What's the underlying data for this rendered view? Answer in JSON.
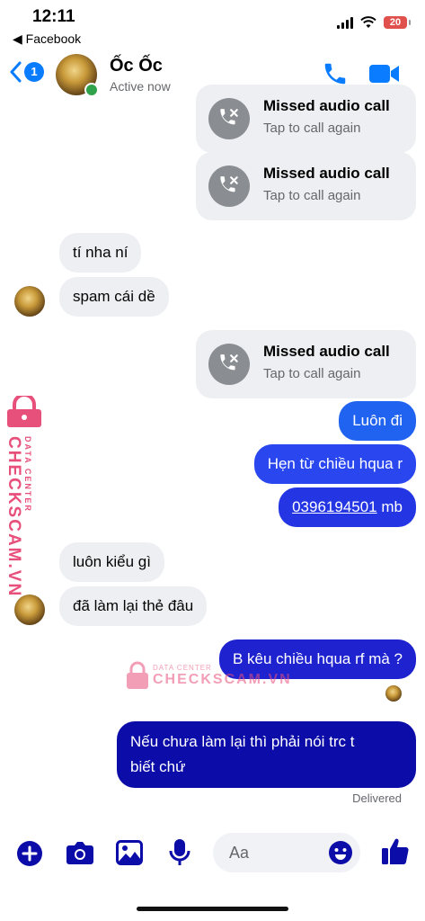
{
  "status_bar": {
    "time": "12:11",
    "back_app": "◀ Facebook",
    "battery": "20"
  },
  "header": {
    "unread_count": "1",
    "contact_name": "Ốc Ốc",
    "contact_status": "Active now"
  },
  "call_card": {
    "title": "Missed audio call",
    "subtitle": "Tap to call again"
  },
  "messages": [
    {
      "text": "tí nha ní",
      "direction": "in"
    },
    {
      "text": "spam cái dề",
      "direction": "in"
    },
    {
      "text": "Luôn đi",
      "direction": "out"
    },
    {
      "text": "Hẹn từ chiều hqua r",
      "direction": "out"
    },
    {
      "link": "0396194501",
      "text": "mb",
      "direction": "out"
    },
    {
      "text": "luôn kiểu gì",
      "direction": "in"
    },
    {
      "text": "đã làm lại thẻ đâu",
      "direction": "in"
    },
    {
      "text": "B kêu chiều hqua rf mà ?",
      "direction": "out"
    },
    {
      "line1": "Nếu chưa làm lại thì phải nói trc t",
      "line2": "biết chứ",
      "direction": "out"
    }
  ],
  "delivered_label": "Delivered",
  "composer": {
    "placeholder": "Aa"
  },
  "watermark": {
    "brand": "CHECKSCAM.VN",
    "tagline": "DATA CENTER"
  },
  "colors": {
    "accent": "#0a7cff",
    "bubble_gradient_top": "#1b7cf6",
    "bubble_gradient_mid": "#2b3ef2",
    "bubble_gradient_bottom": "#0c0ca8",
    "incoming_bubble": "#eeeff2",
    "online": "#31a24c",
    "watermark": "#e8507c"
  }
}
